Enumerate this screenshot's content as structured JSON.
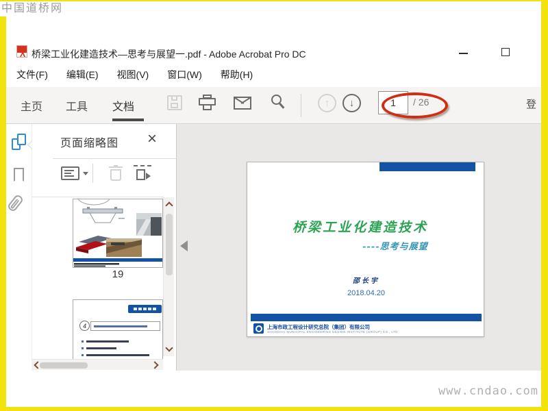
{
  "watermark": {
    "site_name": "中国道桥网",
    "site_url": "www.cndao.com"
  },
  "titlebar": {
    "title": "桥梁工业化建造技术—思考与展望一.pdf - Adobe Acrobat Pro DC"
  },
  "menubar": {
    "items": [
      "文件(F)",
      "编辑(E)",
      "视图(V)",
      "窗口(W)",
      "帮助(H)"
    ]
  },
  "toolbar": {
    "tabs": [
      {
        "label": "主页"
      },
      {
        "label": "工具"
      },
      {
        "label": "文档"
      }
    ],
    "active_tab": "文档",
    "page_number": "1",
    "page_total": "/ 26",
    "signin": "登",
    "icons": [
      "save-icon",
      "print-icon",
      "email-icon",
      "search-icon",
      "page-up-icon",
      "page-down-icon"
    ]
  },
  "sidebar_rail": {
    "icons": [
      "page-thumbnails-icon",
      "bookmarks-icon",
      "attachments-icon"
    ]
  },
  "thumbnail_panel": {
    "title": "页面缩略图",
    "close_glyph": "×",
    "toolbar_icons": [
      "thumbnail-options-icon",
      "delete-page-icon",
      "extract-page-icon"
    ],
    "visible_page_label": "19",
    "next_thumbnail_badge_number": "4"
  },
  "document": {
    "slide": {
      "title": "桥梁工业化建造技术",
      "subtitle": "----思考与展望",
      "author": "邵长宇",
      "date": "2018.04.20",
      "company_cn": "上海市政工程设计研究总院（集团）有限公司",
      "company_en": "SHANGHAI MUNICIPAL ENGINEERING DESIGN INSTITUTE (GROUP) CO., LTD"
    }
  },
  "colors": {
    "frame_yellow": "#F2E20D",
    "accent_blue": "#1353A5",
    "slide_title_green": "#2BA353",
    "slide_subtitle_teal": "#3596B8",
    "annotation_red": "#CF2E12",
    "active_rail_icon_blue": "#2E8AD2"
  }
}
